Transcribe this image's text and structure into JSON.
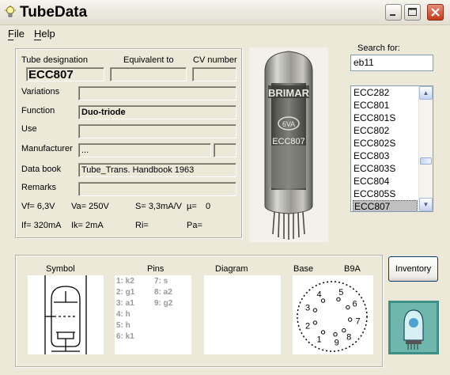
{
  "window": {
    "title": "TubeData",
    "min_icon": "minimize-icon",
    "max_icon": "maximize-icon",
    "close_icon": "close-icon"
  },
  "menu": {
    "file": "File",
    "help": "Help"
  },
  "details": {
    "col_designation": "Tube designation",
    "col_equivalent": "Equivalent to",
    "col_cv": "CV number",
    "designation": "ECC807",
    "equivalent": "",
    "cv_number": "",
    "variations_label": "Variations",
    "variations": "",
    "function_label": "Function",
    "function": "Duo-triode",
    "use_label": "Use",
    "use": "",
    "manufacturer_label": "Manufacturer",
    "manufacturer": "...",
    "databook_label": "Data book",
    "databook": "Tube_Trans. Handbook 1963",
    "remarks_label": "Remarks",
    "remarks": "",
    "vf": "Vf= 6,3V",
    "va": "Va= 250V",
    "s": "S= 3,3mA/V",
    "mu": "µ=",
    "mu_val": "0",
    "if": "If= 320mA",
    "ik": "Ik= 2mA",
    "ri": "Ri=",
    "pa": "Pa="
  },
  "search": {
    "label": "Search for:",
    "value": "eb11",
    "list": [
      "ECC282",
      "ECC801",
      "ECC801S",
      "ECC802",
      "ECC802S",
      "ECC803",
      "ECC803S",
      "ECC804",
      "ECC805S",
      "ECC807"
    ],
    "selected_index": 9
  },
  "photo": {
    "tube_text_top": "BRIMAR",
    "tube_code": "6VA",
    "tube_text_bottom": "ECC807"
  },
  "bottom": {
    "symbol_label": "Symbol",
    "pins_label": "Pins",
    "diagram_label": "Diagram",
    "base_label": "Base",
    "base_type": "B9A",
    "pins_left": [
      "1: k2",
      "2: g1",
      "3: a1",
      "4: h",
      "5: h",
      "6: k1"
    ],
    "pins_right": [
      "7: s",
      "8: a2",
      "9: g2"
    ],
    "base_pins": [
      "1",
      "2",
      "3",
      "4",
      "5",
      "6",
      "7",
      "8",
      "9"
    ],
    "inventory_button": "Inventory"
  },
  "colors": {
    "window_bg": "#ece9d8",
    "selection": "#c0c0c0",
    "close_red": "#c6391b"
  }
}
